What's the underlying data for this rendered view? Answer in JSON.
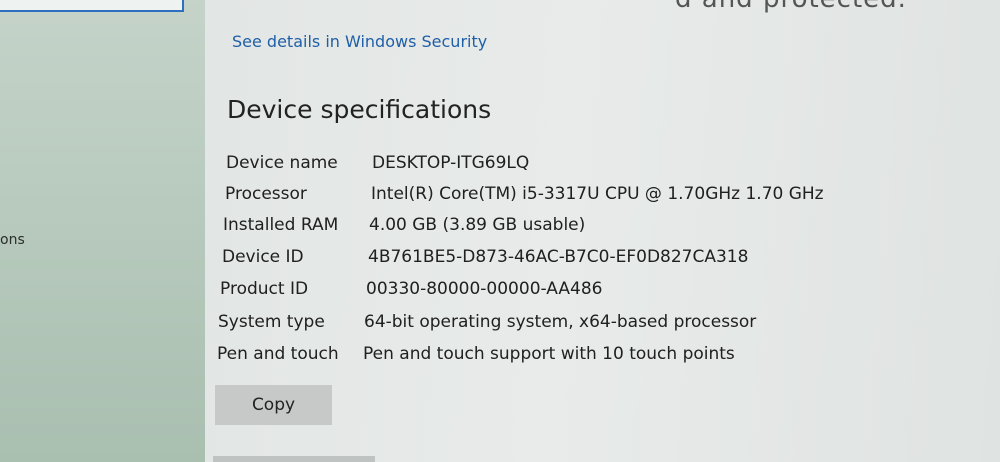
{
  "nav": {
    "partial_label": "ons"
  },
  "header": {
    "clipped_text": "d and protected."
  },
  "security_link": "See details in Windows Security",
  "section_title": "Device specifications",
  "specs": [
    {
      "label": "Device name",
      "value": "DESKTOP-ITG69LQ"
    },
    {
      "label": "Processor",
      "value": "Intel(R) Core(TM) i5-3317U CPU @ 1.70GHz   1.70 GHz"
    },
    {
      "label": "Installed RAM",
      "value": "4.00 GB (3.89 GB usable)"
    },
    {
      "label": "Device ID",
      "value": "4B761BE5-D873-46AC-B7C0-EF0D827CA318"
    },
    {
      "label": "Product ID",
      "value": "00330-80000-00000-AA486"
    },
    {
      "label": "System type",
      "value": "64-bit operating system, x64-based processor"
    },
    {
      "label": "Pen and touch",
      "value": "Pen and touch support with 10 touch points"
    }
  ],
  "copy_button": "Copy",
  "colors": {
    "link": "#1f5fa8",
    "focus_border": "#2f6fc2"
  }
}
